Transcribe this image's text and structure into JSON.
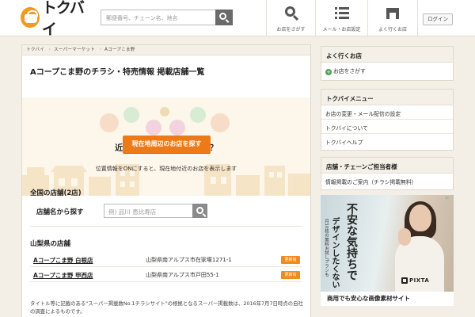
{
  "header": {
    "logo_text": "トクバイ",
    "search_placeholder": "郵便番号、チェーン名、地名",
    "nav": [
      {
        "label": "お店をさがす",
        "icon": "search-icon"
      },
      {
        "label": "メール・お店設定",
        "icon": "list-icon"
      },
      {
        "label": "よく行くお店",
        "icon": "store-icon"
      }
    ],
    "login_label": "ログイン"
  },
  "breadcrumb": [
    "トクバイ",
    "スーパーマーケット",
    "Aコープこま野"
  ],
  "page_title": "Aコープこま野のチラシ・特売情報 掲載店舗一覧",
  "hero": {
    "question": "近くのお店をお探しですか？",
    "sub": "位置情報をONにすると、現在地付近のお店を表示します",
    "button_label": "現在地周辺のお店を探す"
  },
  "all_stores_heading": "全国の店舗(2店)",
  "store_search": {
    "label": "店舗名から探す",
    "placeholder": "例) 品川 恵比寿店"
  },
  "prefecture_heading": "山梨県の店舗",
  "stores": [
    {
      "name": "Aコープこま野 白根店",
      "address": "山梨県南アルプス市在家塚1271-1",
      "badge": "更新有"
    },
    {
      "name": "Aコープこま野 甲西店",
      "address": "山梨県南アルプス市戸田55-1",
      "badge": "更新有"
    }
  ],
  "footnote": "タイトル等に記載のある\"スーパー掲載数No.1チラシサイト\"の根拠となるスーパー掲載数は、2016年7月7日時点の自社の調査によるものです。",
  "sidebar": {
    "frequent": {
      "heading": "よく行くお店",
      "link": "お店をさがす"
    },
    "menu": {
      "heading": "トクバイメニュー",
      "items": [
        "お店の変更・メール配信の設定",
        "トクバイについて",
        "トクバイヘルプ"
      ]
    },
    "business": {
      "heading": "店舗・チェーンご担当者様",
      "items": [
        "情報掲載のご案内（チラシ掲載無料）"
      ]
    }
  },
  "ad": {
    "line1": "不安な気持ちで",
    "line2": "デザインしたくない",
    "line3": "月10枚の無料お試しプランも",
    "brand": "PIXTA",
    "footer": "商用でも安心な画像素材サイト"
  },
  "colors": {
    "accent": "#ee7a17",
    "badge": "#f08c1e",
    "background": "#f3efe6"
  }
}
